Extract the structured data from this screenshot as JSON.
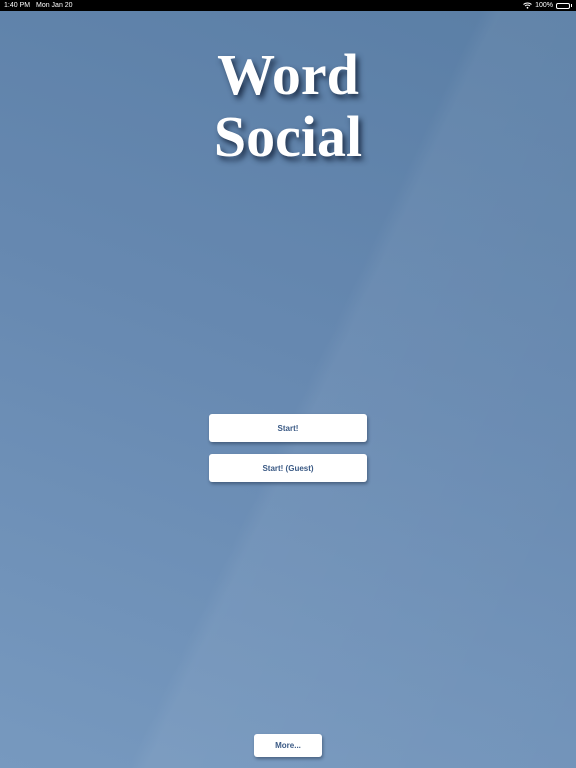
{
  "status_bar": {
    "time": "1:40 PM",
    "date": "Mon Jan 20",
    "battery": "100%",
    "icons": [
      "wifi-icon",
      "battery-icon"
    ]
  },
  "title": {
    "line1": "Word",
    "line2": "Social"
  },
  "buttons": {
    "start": "Start!",
    "start_guest": "Start!  (Guest)",
    "more": "More..."
  },
  "colors": {
    "background": "#6688b0",
    "button_text": "#3b5a85",
    "button_bg": "#ffffff"
  }
}
